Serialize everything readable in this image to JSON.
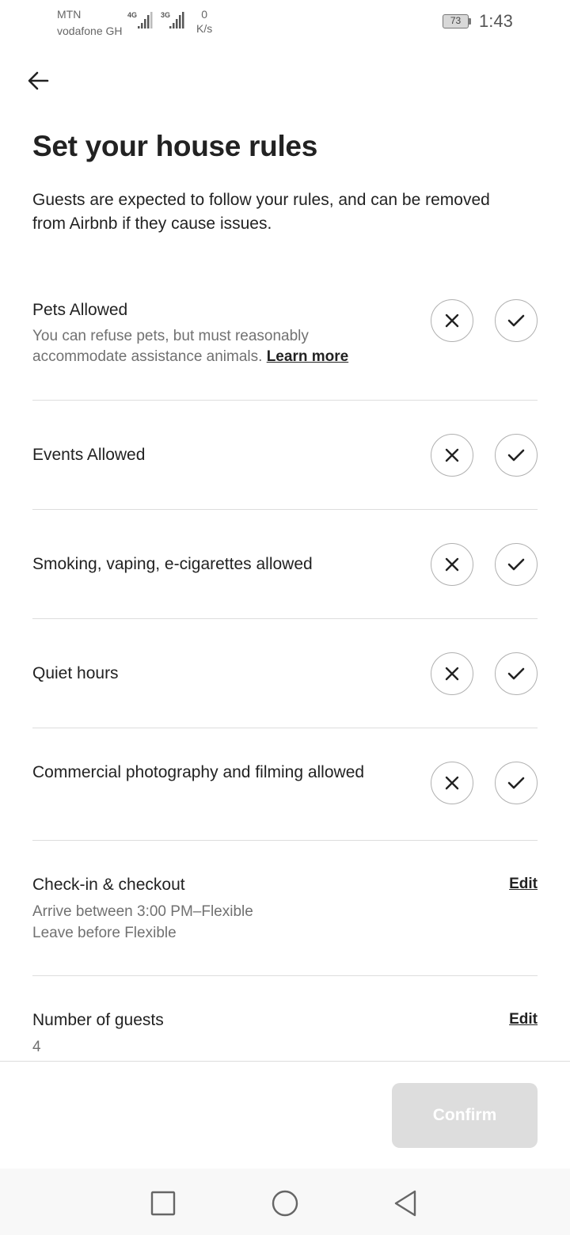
{
  "status_bar": {
    "carrier_1": "MTN",
    "carrier_2": "vodafone GH",
    "net_1": "4G",
    "net_2": "3G",
    "speed_value": "0",
    "speed_unit": "K/s",
    "battery": "73",
    "time": "1:43"
  },
  "header": {
    "back_icon": "arrow-left-icon",
    "title": "Set your house rules",
    "subtitle": "Guests are expected to follow your rules, and can be removed from Airbnb if they cause issues."
  },
  "rules": [
    {
      "label": "Pets Allowed",
      "description": "You can refuse pets, but must reasonably accommodate assistance animals.",
      "link": "Learn more"
    },
    {
      "label": "Events Allowed"
    },
    {
      "label": "Smoking, vaping, e-cigarettes allowed"
    },
    {
      "label": "Quiet hours"
    },
    {
      "label": "Commercial photography and filming allowed"
    }
  ],
  "checkin": {
    "label": "Check-in & checkout",
    "edit": "Edit",
    "arrive": "Arrive between 3:00 PM–Flexible",
    "leave": "Leave before Flexible"
  },
  "guests": {
    "label": "Number of guests",
    "edit": "Edit",
    "value": "4"
  },
  "footer": {
    "confirm": "Confirm"
  },
  "icons": {
    "no": "close-icon",
    "yes": "check-icon"
  },
  "colors": {
    "text": "#222222",
    "secondary": "#717171",
    "divider": "#DDDDDD",
    "disabled_button": "#DDDDDD"
  }
}
